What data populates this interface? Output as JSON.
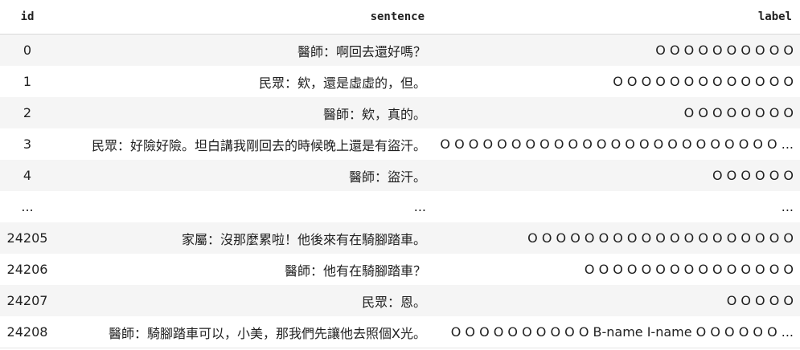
{
  "table": {
    "columns": [
      "id",
      "sentence",
      "label"
    ],
    "rows": [
      {
        "id": "0",
        "sentence": "醫師：啊回去還好嗎？",
        "label": "O O O O O O O O O O"
      },
      {
        "id": "1",
        "sentence": "民眾：欸，還是虛虛的，但。",
        "label": "O O O O O O O O O O O O O"
      },
      {
        "id": "2",
        "sentence": "醫師：欸，真的。",
        "label": "O O O O O O O O"
      },
      {
        "id": "3",
        "sentence": "民眾：好險好險。坦白講我剛回去的時候晚上還是有盜汗。",
        "label": "O O O O O O O O O O O O O O O O O O O O O O O O ..."
      },
      {
        "id": "4",
        "sentence": "醫師：盜汗。",
        "label": "O O O O O O"
      },
      {
        "id": "...",
        "sentence": "...",
        "label": "..."
      },
      {
        "id": "24205",
        "sentence": "家屬：沒那麼累啦！他後來有在騎腳踏車。",
        "label": "O O O O O O O O O O O O O O O O O O O"
      },
      {
        "id": "24206",
        "sentence": "醫師：他有在騎腳踏車？",
        "label": "O O O O O O O O O O O O O O O"
      },
      {
        "id": "24207",
        "sentence": "民眾：恩。",
        "label": "O O O O O"
      },
      {
        "id": "24208",
        "sentence": "醫師：騎腳踏車可以，小美，那我們先讓他去照個X光。",
        "label": "O O O O O O O O O O B-name I-name O O O O O O ..."
      }
    ]
  }
}
